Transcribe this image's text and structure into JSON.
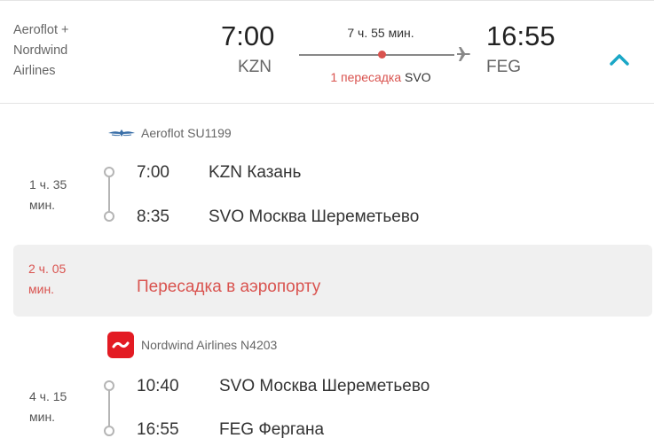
{
  "summary": {
    "airlines": "Aeroflot +\nNordwind\nAirlines",
    "departure_time": "7:00",
    "departure_code": "KZN",
    "arrival_time": "16:55",
    "arrival_code": "FEG",
    "total_duration": "7 ч. 55 мин.",
    "transfer_count": "1 пересадка",
    "transfer_airport": "SVO"
  },
  "segments": [
    {
      "carrier": "Aeroflot SU1199",
      "carrier_logo": "aeroflot-logo",
      "duration_line1": "1 ч. 35",
      "duration_line2": "мин.",
      "dep_time": "7:00",
      "dep_place": "KZN Казань",
      "arr_time": "8:35",
      "arr_place": "SVO Москва Шереметьево"
    },
    {
      "carrier": "Nordwind Airlines N4203",
      "carrier_logo": "nordwind-logo",
      "duration_line1": "4 ч. 15",
      "duration_line2": "мин.",
      "dep_time": "10:40",
      "dep_place": "SVO Москва Шереметьево",
      "arr_time": "16:55",
      "arr_place": "FEG Фергана"
    }
  ],
  "transfer": {
    "duration_line1": "2 ч. 05",
    "duration_line2": "мин.",
    "label": "Пересадка в аэропорту"
  },
  "colors": {
    "accent": "#1aa7c6",
    "transfer": "#d9534f",
    "nordwind": "#e31b23"
  },
  "icons": {
    "collapse": "chevron-up-icon",
    "plane": "plane-icon"
  }
}
